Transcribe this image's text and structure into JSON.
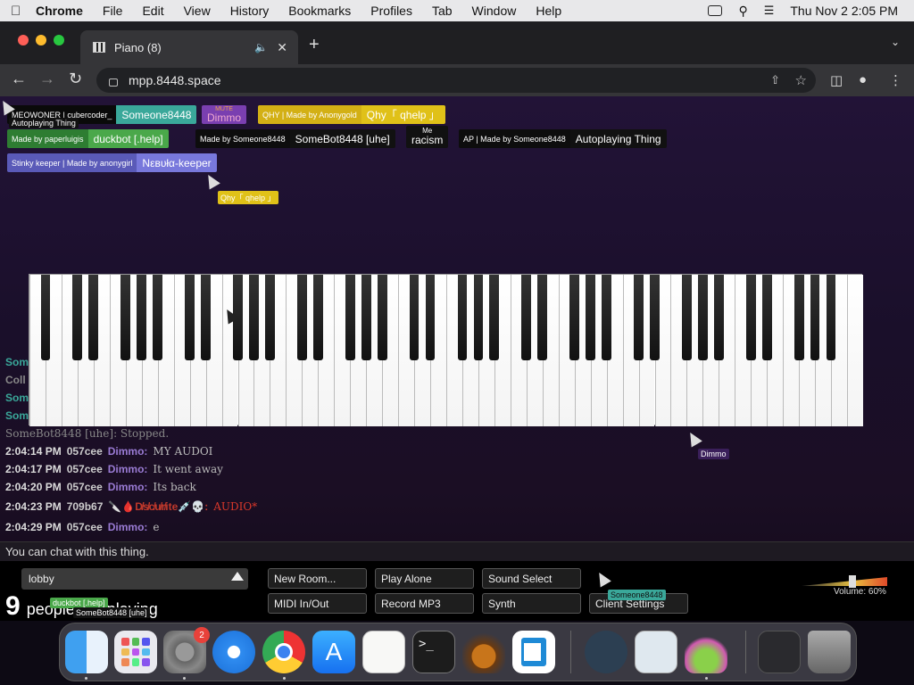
{
  "menubar": {
    "items": [
      "Chrome",
      "File",
      "Edit",
      "View",
      "History",
      "Bookmarks",
      "Profiles",
      "Tab",
      "Window",
      "Help"
    ],
    "datetime": "Thu Nov 2  2:05 PM"
  },
  "browser": {
    "tab_title": "Piano (8)",
    "url": "mpp.8448.space"
  },
  "participants": [
    {
      "tag": "MEOWONER | cubercoder_",
      "name": "Someone8448",
      "color": "#3aa89a"
    },
    {
      "tag": "MUTE",
      "name": "Dimmo",
      "color": "#7a3fb0"
    },
    {
      "tag": "QHY | Made by Anonygold",
      "name": "Qhy「 qhelp 」",
      "color": "#e0c118"
    },
    {
      "tag": "Made by paperluigis",
      "name": "duckbot [.help]",
      "color": "#4aa84a"
    },
    {
      "tag": "Made by Someone8448",
      "name": "SomeBot8448 [uhe]",
      "color": "#111111"
    },
    {
      "tag": "Me",
      "name": "racism",
      "color": "#111111"
    },
    {
      "tag": "AP | Made by Someone8448",
      "name": "Autoplaying Thing",
      "color": "#111111"
    },
    {
      "tag": "Stinky keeper | Made by anonygirl",
      "name": "Νεвυłα-keeper",
      "color": "#6b6bd0"
    }
  ],
  "cursor_labels": {
    "c1": "Autoplaying Thing",
    "c2": "Qhy「 qhelp 」",
    "c3": "Dimmo",
    "c4": "Someone8448",
    "c5": "duckbot [.help]",
    "c6": "SomeBot8448 [uhe]"
  },
  "chat_partial": [
    "Som",
    "Coll",
    "Som",
    "Som"
  ],
  "chat_stopped": "SomeBot8448 [uhe]:  Stopped.",
  "chat": [
    {
      "time": "2:04:14 PM",
      "id": "057cee",
      "user": "Dimmo:",
      "msg": "MY AUDOI",
      "color": "#9a7bd4",
      "msgcolor": "#bbb"
    },
    {
      "time": "2:04:17 PM",
      "id": "057cee",
      "user": "Dimmo:",
      "msg": "It went away",
      "color": "#9a7bd4",
      "msgcolor": "#bbb"
    },
    {
      "time": "2:04:20 PM",
      "id": "057cee",
      "user": "Dimmo:",
      "msg": "Its back",
      "color": "#9a7bd4",
      "msgcolor": "#bbb"
    },
    {
      "time": "2:04:23 PM",
      "id": "709b67",
      "user": "🔪🩸D̸̸̸s̸̸c̸u̸r̸ite💉💀:",
      "msg": "AUDIO*",
      "color": "#c0392b",
      "msgcolor": "#d9382b"
    },
    {
      "time": "2:04:29 PM",
      "id": "057cee",
      "user": "Dimmo:",
      "msg": "e",
      "color": "#9a7bd4",
      "msgcolor": "#bbb"
    }
  ],
  "chat_placeholder": "You can chat with this thing.",
  "room": "lobby",
  "buttons": {
    "new_room": "New Room...",
    "play_alone": "Play Alone",
    "sound_select": "Sound Select",
    "midi": "MIDI In/Out",
    "record": "Record MP3",
    "synth": "Synth",
    "client_settings": "Client Settings"
  },
  "playing": {
    "count": "9",
    "text": "people are playing"
  },
  "volume": {
    "label": "Volume: 60%",
    "value": 0.6
  },
  "dock": {
    "settings_badge": "2",
    "apps": [
      "finder-icon",
      "launchpad-icon",
      "system-settings-icon",
      "safari-icon",
      "chrome-icon",
      "app-store-icon",
      "textedit-icon",
      "terminal-icon",
      "garageband-icon",
      "vscode-icon",
      "nox-icon",
      "preview-icon",
      "flask-icon",
      "downloads-stack-icon",
      "trash-icon"
    ]
  }
}
